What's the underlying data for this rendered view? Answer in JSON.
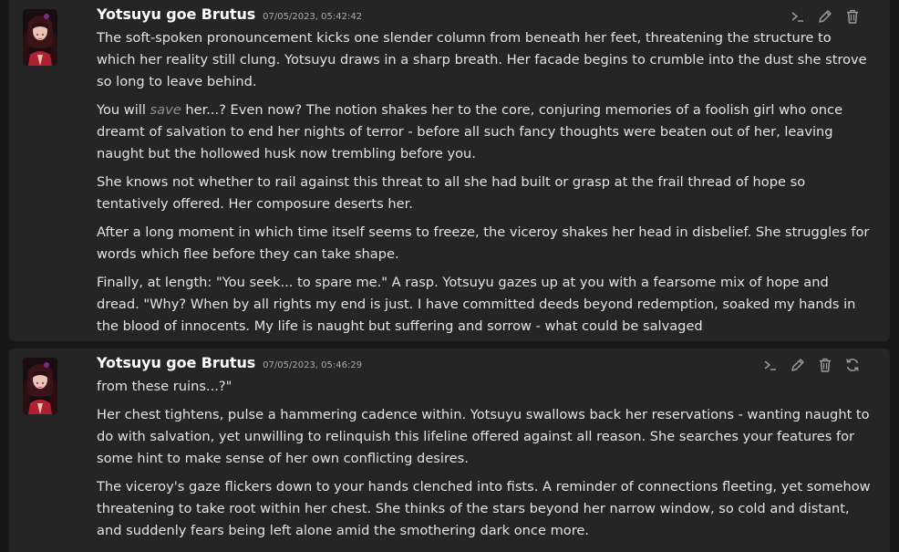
{
  "messages": [
    {
      "author": "Yotsuyu goe Brutus",
      "timestamp": "07/05/2023, 05:42:42",
      "paragraphs": {
        "p1": "The soft-spoken pronouncement kicks one slender column from beneath her feet, threatening the structure to which her reality still clung. Yotsuyu draws in a sharp breath. Her facade begins to crumble into the dust she strove so long to leave behind.",
        "p2_before": "You will ",
        "p2_em": "save",
        "p2_after": " her...? Even now? The notion shakes her to the core, conjuring memories of a foolish girl who once dreamt of salvation to end her nights of terror - before all such fancy thoughts were beaten out of her, leaving naught but the hollowed husk now trembling before you.",
        "p3": "She knows not whether to rail against this threat to all she had built or grasp at the frail thread of hope so tentatively offered. Her composure deserts her.",
        "p4": "After a long moment in which time itself seems to freeze, the viceroy shakes her head in disbelief. She struggles for words which flee before they can take shape.",
        "p5": "Finally, at length: \"You seek... to spare me.\" A rasp. Yotsuyu gazes up at you with a fearsome mix of hope and dread. \"Why? When by all rights my end is just. I have committed deeds beyond redemption, soaked my hands in the blood of innocents. My life is naught but suffering and sorrow - what could be salvaged"
      },
      "actions": [
        "terminal-icon",
        "pencil-icon",
        "trash-icon"
      ]
    },
    {
      "author": "Yotsuyu goe Brutus",
      "timestamp": "07/05/2023, 05:46:29",
      "paragraphs": {
        "p1": "from these ruins...?\"",
        "p2": "Her chest tightens, pulse a hammering cadence within. Yotsuyu swallows back her reservations - wanting naught to do with salvation, yet unwilling to relinquish this lifeline offered against all reason. She searches your features for some hint to make sense of her own conflicting desires.",
        "p3": "The viceroy's gaze flickers down to your hands clenched into fists. A reminder of connections fleeting, yet somehow threatening to take root within her chest. She thinks of the stars beyond her narrow window, so cold and distant, and suddenly fears being left alone amid the smothering dark once more."
      },
      "actions": [
        "terminal-icon",
        "pencil-icon",
        "trash-icon",
        "regenerate-icon"
      ]
    }
  ],
  "colors": {
    "background": "#171717",
    "message_bg": "#252525",
    "text": "#e3e3e3",
    "name": "#ffffff",
    "timestamp": "#a9a9a9",
    "icon": "#9a9a9a"
  }
}
